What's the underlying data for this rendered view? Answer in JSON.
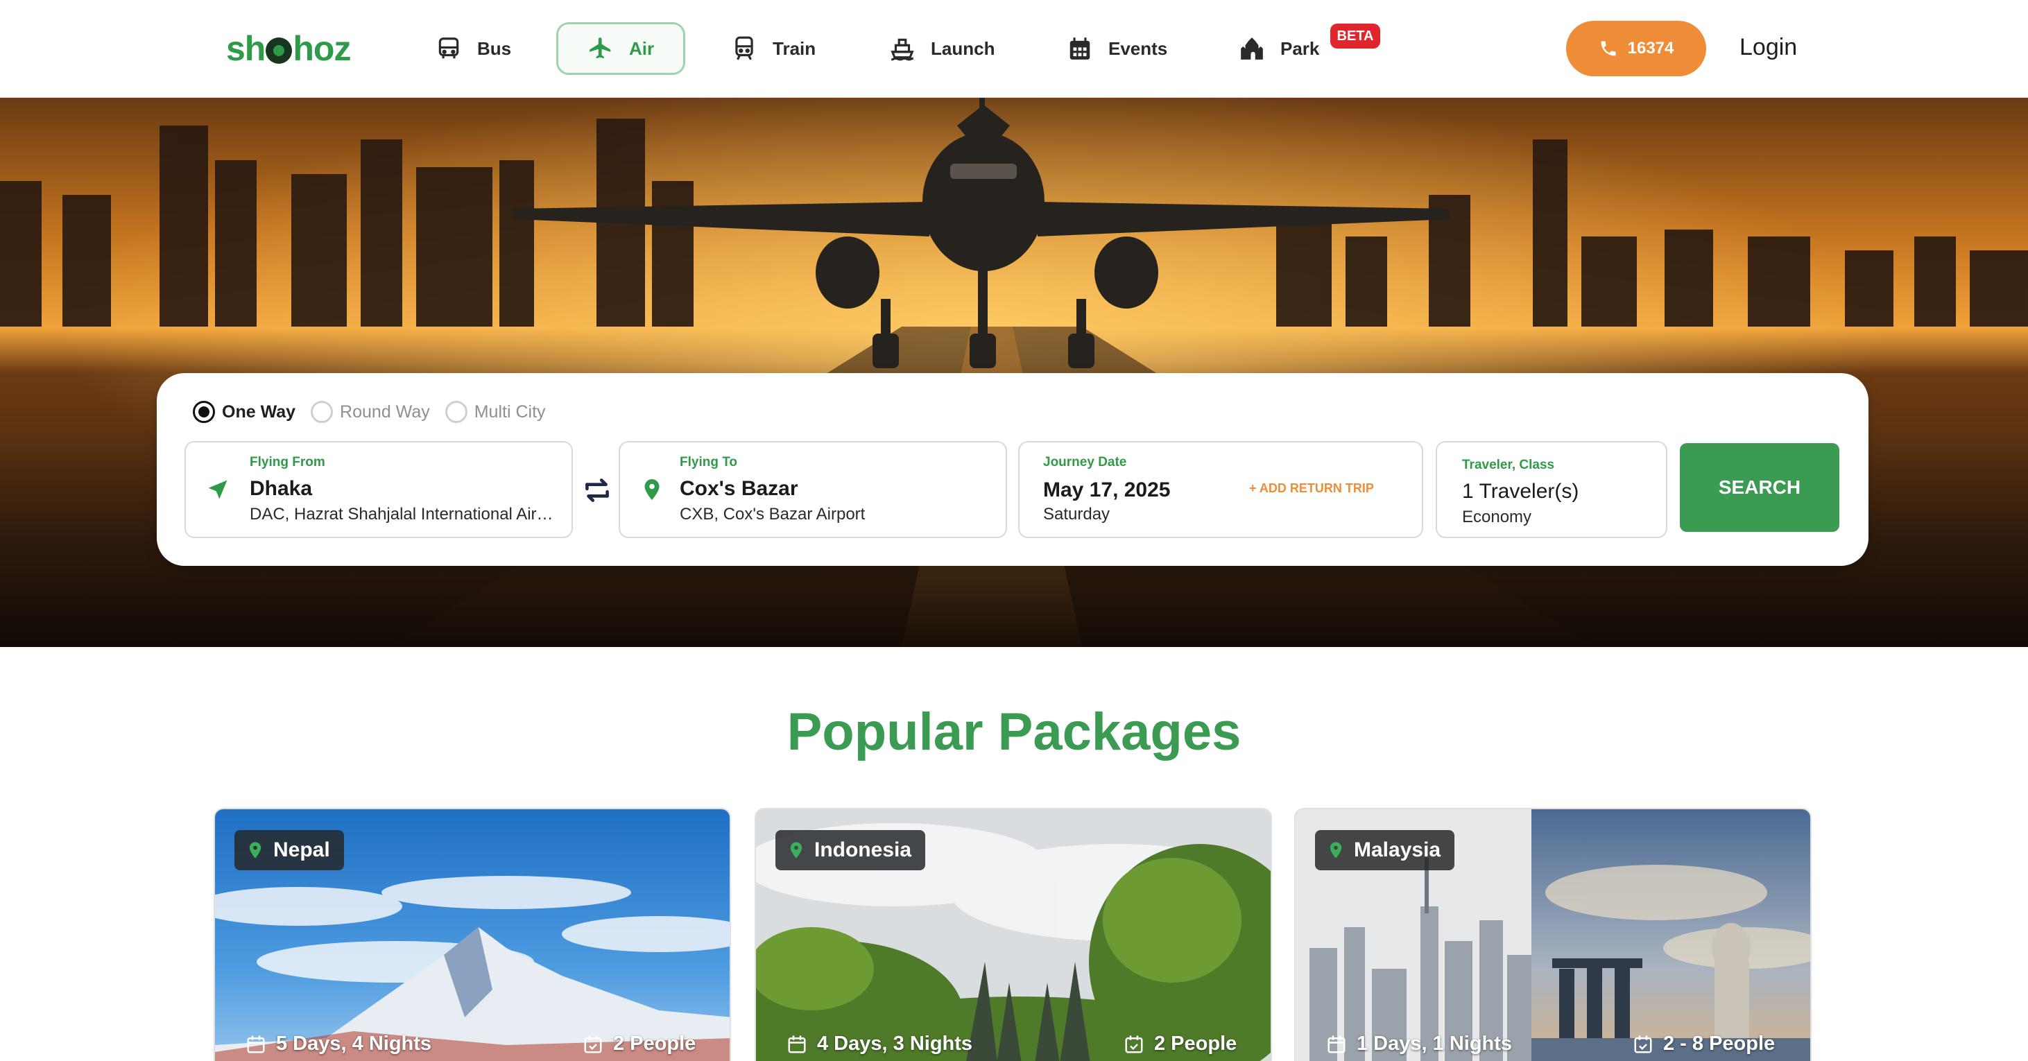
{
  "brand": {
    "logo_text_left": "sh",
    "logo_text_right": "hoz"
  },
  "nav": {
    "items": [
      {
        "label": "Bus",
        "icon": "bus-icon"
      },
      {
        "label": "Air",
        "icon": "airplane-icon",
        "active": true
      },
      {
        "label": "Train",
        "icon": "train-icon"
      },
      {
        "label": "Launch",
        "icon": "ship-icon"
      },
      {
        "label": "Events",
        "icon": "calendar-icon"
      },
      {
        "label": "Park",
        "icon": "castle-icon",
        "badge": "BETA"
      }
    ],
    "hotline": "16374",
    "login": "Login"
  },
  "search": {
    "trip_types": [
      "One Way",
      "Round Way",
      "Multi City"
    ],
    "selected_trip_type": "One Way",
    "from": {
      "label": "Flying From",
      "city": "Dhaka",
      "airport": "DAC, Hazrat Shahjalal International Airport"
    },
    "to": {
      "label": "Flying To",
      "city": "Cox's Bazar",
      "airport": "CXB, Cox's Bazar Airport"
    },
    "date": {
      "label": "Journey Date",
      "value": "May 17, 2025",
      "weekday": "Saturday",
      "add_return": "+ ADD RETURN TRIP"
    },
    "traveler": {
      "label": "Traveler, Class",
      "count": "1 Traveler(s)",
      "class": "Economy"
    },
    "button": "SEARCH"
  },
  "packages": {
    "title": "Popular Packages",
    "cards": [
      {
        "location": "Nepal",
        "duration": "5 Days, 4 Nights",
        "people": "2 People"
      },
      {
        "location": "Indonesia",
        "duration": "4 Days, 3 Nights",
        "people": "2 People"
      },
      {
        "location": "Malaysia",
        "duration": "1 Days, 1 Nights",
        "people": "2 - 8 People"
      }
    ]
  },
  "colors": {
    "brand_green": "#3b9b52",
    "accent_orange": "#ef8c38",
    "beta_red": "#e0252c"
  }
}
